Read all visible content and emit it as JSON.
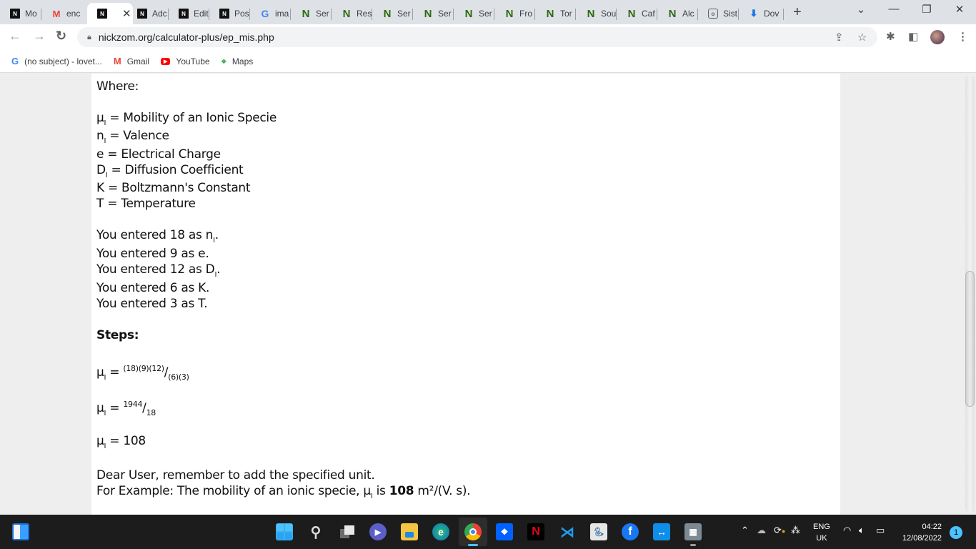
{
  "browser": {
    "tabs": [
      {
        "label": "Mo",
        "icon": "nickzom-icon",
        "active": false
      },
      {
        "label": "enc",
        "icon": "gmail-icon",
        "active": false
      },
      {
        "label": "",
        "icon": "nickzom-icon",
        "active": true
      },
      {
        "label": "Adc",
        "icon": "nickzom-icon",
        "active": false
      },
      {
        "label": "Edit",
        "icon": "nickzom-icon",
        "active": false
      },
      {
        "label": "Pos",
        "icon": "nickzom-icon",
        "active": false
      },
      {
        "label": "ima",
        "icon": "google-icon",
        "active": false
      },
      {
        "label": "Ser",
        "icon": "n-icon",
        "active": false
      },
      {
        "label": "Res",
        "icon": "n-icon",
        "active": false
      },
      {
        "label": "Ser",
        "icon": "n-icon",
        "active": false
      },
      {
        "label": "Ser",
        "icon": "n-icon",
        "active": false
      },
      {
        "label": "Ser",
        "icon": "n-icon",
        "active": false
      },
      {
        "label": "Fro",
        "icon": "n-icon",
        "active": false
      },
      {
        "label": "Tor",
        "icon": "n-icon",
        "active": false
      },
      {
        "label": "Sou",
        "icon": "n-icon",
        "active": false
      },
      {
        "label": "Caf",
        "icon": "n-icon",
        "active": false
      },
      {
        "label": "Alc",
        "icon": "n-icon",
        "active": false
      },
      {
        "label": "Sist",
        "icon": "sist-icon",
        "active": false
      },
      {
        "label": "Dov",
        "icon": "download-icon",
        "active": false
      }
    ],
    "new_tab_symbol": "+",
    "tab_search_symbol": "⌄",
    "minimize_symbol": "—",
    "restore_symbol": "❐",
    "close_symbol": "✕",
    "url": "nickzom.org/calculator-plus/ep_mis.php",
    "bookmarks": [
      {
        "label": "(no subject) - lovet...",
        "icon": "google-icon"
      },
      {
        "label": "Gmail",
        "icon": "gmail-icon"
      },
      {
        "label": "YouTube",
        "icon": "youtube-icon"
      },
      {
        "label": "Maps",
        "icon": "maps-icon"
      }
    ]
  },
  "page": {
    "where_label": "Where:",
    "definitions": [
      {
        "symbol": "μ",
        "sub": "I",
        "text": " = Mobility of an Ionic Specie"
      },
      {
        "symbol": "n",
        "sub": "I",
        "text": " = Valence"
      },
      {
        "symbol": "e",
        "sub": "",
        "text": " = Electrical Charge"
      },
      {
        "symbol": "D",
        "sub": "I",
        "text": " = Diffusion Coefficient"
      },
      {
        "symbol": "K",
        "sub": "",
        "text": " = Boltzmann's Constant"
      },
      {
        "symbol": "T",
        "sub": "",
        "text": " = Temperature"
      }
    ],
    "entered": [
      {
        "prefix": "You entered 18 as ",
        "symbol": "n",
        "sub": "I",
        "suffix": "."
      },
      {
        "prefix": "You entered 9 as ",
        "symbol": "e",
        "sub": "",
        "suffix": "."
      },
      {
        "prefix": "You entered 12 as ",
        "symbol": "D",
        "sub": "I",
        "suffix": "."
      },
      {
        "prefix": "You entered 6 as ",
        "symbol": "K",
        "sub": "",
        "suffix": "."
      },
      {
        "prefix": "You entered 3 as ",
        "symbol": "T",
        "sub": "",
        "suffix": "."
      }
    ],
    "steps_label": "Steps:",
    "steps": [
      {
        "lhs": "μ",
        "lhs_sub": "I",
        "eq": " = ",
        "numerator": "(18)(9)(12)",
        "slash": "/",
        "denominator": "(6)(3)"
      },
      {
        "lhs": "μ",
        "lhs_sub": "I",
        "eq": " = ",
        "numerator": "1944",
        "slash": "/",
        "denominator": "18"
      },
      {
        "lhs": "μ",
        "lhs_sub": "I",
        "eq": " = ",
        "result": "108"
      }
    ],
    "reminder": "Dear User, remember to add the specified unit.",
    "example_prefix": "For Example: The mobility of an ionic specie, ",
    "example_symbol": "μ",
    "example_sub": "I",
    "example_mid": " is ",
    "example_value": "108",
    "example_unit": " m²/(V. s)."
  },
  "taskbar": {
    "apps": [
      "widgets",
      "start",
      "search",
      "task-view",
      "teams-chat",
      "file-explorer",
      "edge",
      "chrome",
      "dropbox",
      "netflix",
      "vscode",
      "python",
      "facebook",
      "teamviewer",
      "calculator"
    ],
    "language_line1": "ENG",
    "language_line2": "UK",
    "time": "04:22",
    "date": "12/08/2022",
    "notification_count": "1"
  }
}
